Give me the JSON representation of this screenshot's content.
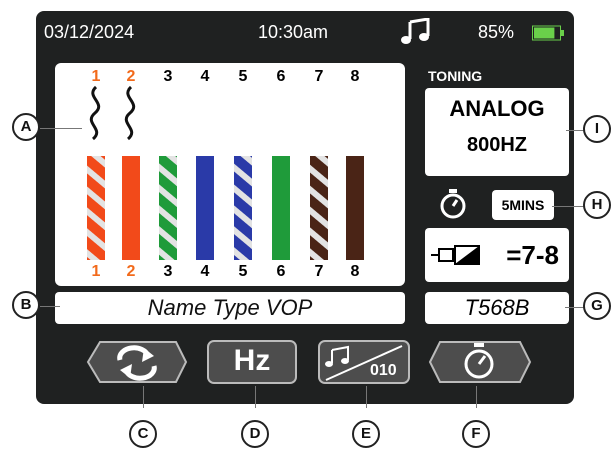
{
  "status_bar": {
    "date": "03/12/2024",
    "time": "10:30am",
    "battery": "85%",
    "battery_level": 0.85,
    "music_icon": "music-note-icon"
  },
  "wiremap": {
    "top_pins": [
      "1",
      "2",
      "3",
      "4",
      "5",
      "6",
      "7",
      "8"
    ],
    "bottom_pins": [
      "1",
      "2",
      "3",
      "4",
      "5",
      "6",
      "7",
      "8"
    ],
    "highlighted_pins": [
      "1",
      "2"
    ],
    "wire_colors": [
      {
        "pin": "1",
        "color": "#f24a1a",
        "striped": true
      },
      {
        "pin": "2",
        "color": "#f24a1a",
        "striped": false
      },
      {
        "pin": "3",
        "color": "#1f9b3a",
        "striped": true
      },
      {
        "pin": "4",
        "color": "#2a3aa8",
        "striped": false
      },
      {
        "pin": "5",
        "color": "#2a3aa8",
        "striped": true
      },
      {
        "pin": "6",
        "color": "#1f9b3a",
        "striped": false
      },
      {
        "pin": "7",
        "color": "#4a2416",
        "striped": true
      },
      {
        "pin": "8",
        "color": "#4a2416",
        "striped": false
      }
    ]
  },
  "name_field": "Name Type VOP",
  "toning": {
    "title": "TONING",
    "mode": "ANALOG",
    "frequency": "800HZ"
  },
  "timer": {
    "value": "5MINS"
  },
  "pair": {
    "text": "=7-8"
  },
  "standard": "T568B",
  "function_buttons": [
    {
      "name": "loop",
      "label": ""
    },
    {
      "name": "hz",
      "label": "Hz"
    },
    {
      "name": "tone-mode",
      "label": "010"
    },
    {
      "name": "timer",
      "label": ""
    }
  ],
  "callouts": {
    "A": "A",
    "B": "B",
    "C": "C",
    "D": "D",
    "E": "E",
    "F": "F",
    "G": "G",
    "H": "H",
    "I": "I"
  }
}
